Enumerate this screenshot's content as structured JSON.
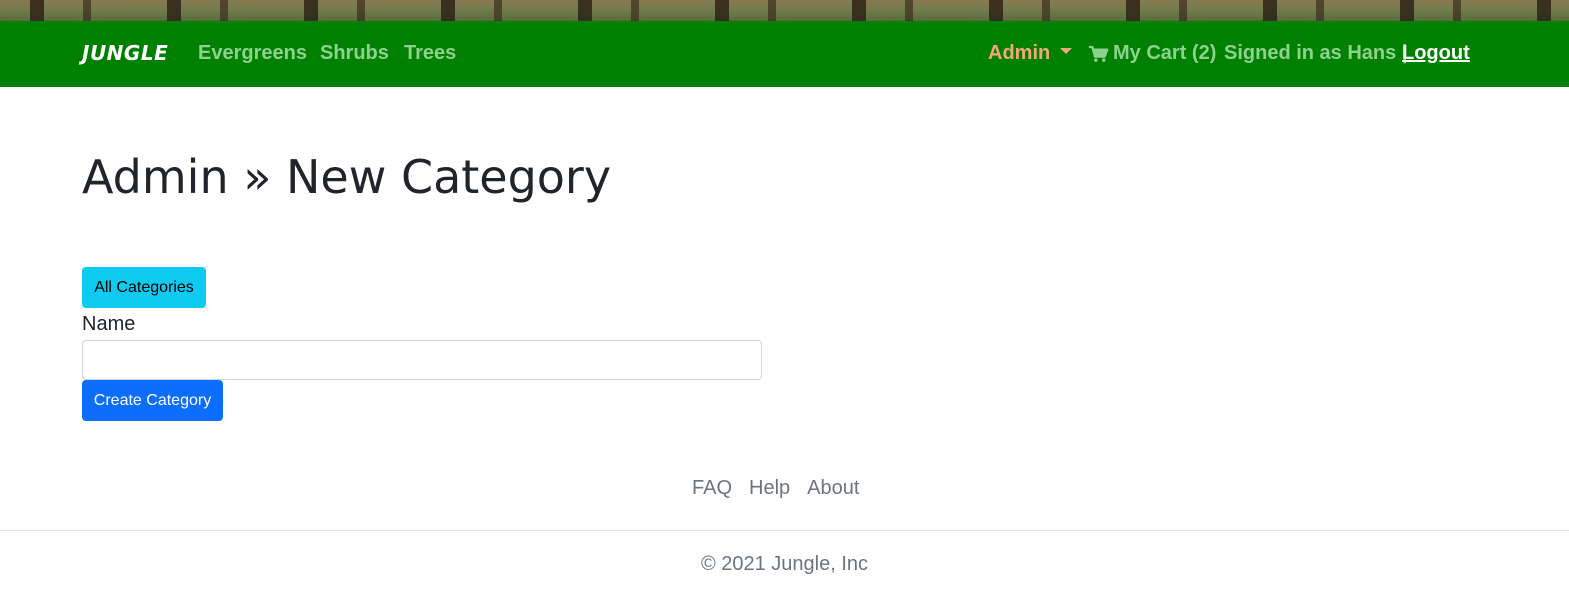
{
  "navbar": {
    "brand": "JUNGLE",
    "links": [
      "Evergreens",
      "Shrubs",
      "Trees"
    ],
    "admin_label": "Admin",
    "cart_label": "My Cart (2)",
    "signed_in_text": "Signed in as Hans",
    "separator": "|",
    "logout_label": "Logout"
  },
  "main": {
    "title": "Admin » New Category",
    "all_categories_label": "All Categories",
    "name_label": "Name",
    "name_value": "",
    "create_label": "Create Category"
  },
  "footer": {
    "links": [
      "FAQ",
      "Help",
      "About"
    ],
    "copyright": "© 2021 Jungle, Inc"
  },
  "colors": {
    "navbar_bg": "#008000",
    "nav_link": "#8fd18f",
    "admin_accent": "#f4a77f",
    "info_button": "#0dcaf0",
    "primary_button": "#0d6efd"
  },
  "icons": {
    "cart": "shopping-cart-icon",
    "caret": "caret-down-icon"
  }
}
